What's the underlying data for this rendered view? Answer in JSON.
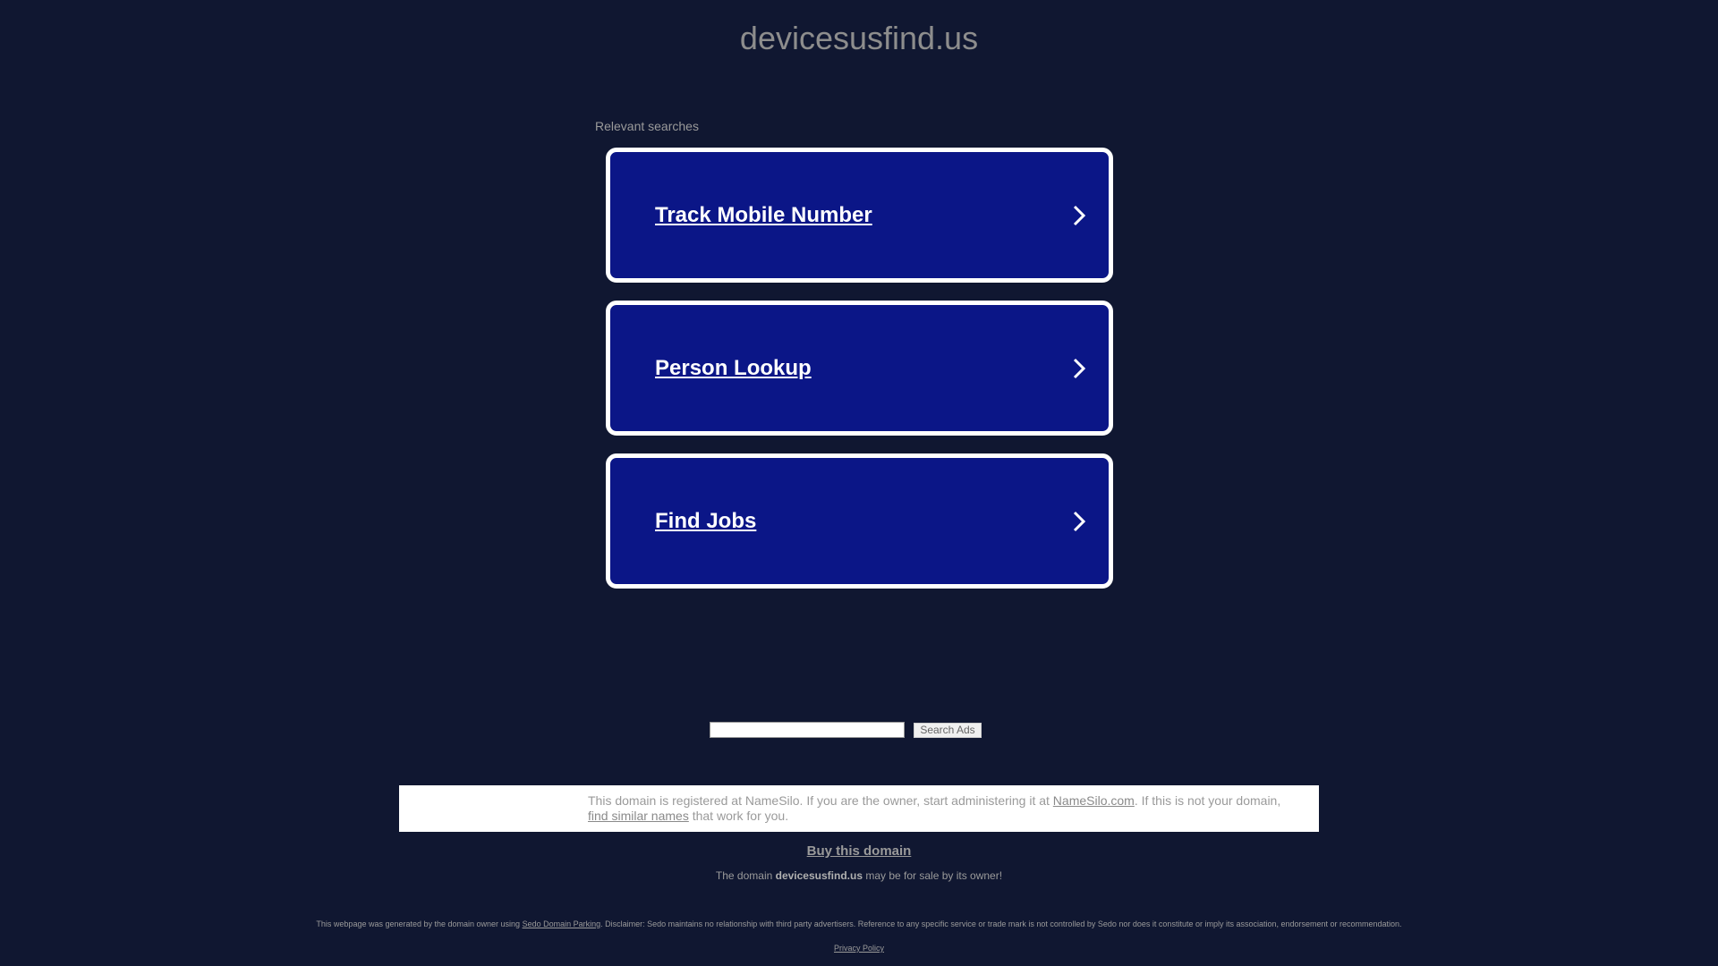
{
  "header": {
    "domain_title": "devicesusfind.us"
  },
  "searches": {
    "label": "Relevant searches",
    "items": [
      {
        "label": "Track Mobile Number"
      },
      {
        "label": "Person Lookup"
      },
      {
        "label": "Find Jobs"
      }
    ]
  },
  "search_box": {
    "input_value": "",
    "button_label": "Search Ads"
  },
  "notice": {
    "text_before": "This domain is registered at NameSilo. If you are the owner, start administering it at ",
    "link1": "NameSilo.com",
    "text_middle": ". If this is not your domain, ",
    "link2": "find similar names",
    "text_after": " that work for you."
  },
  "sale": {
    "buy_label": "Buy this domain",
    "prefix": "The domain ",
    "domain": "devicesusfind.us",
    "suffix": " may be for sale by its owner!"
  },
  "footer": {
    "disclaimer_before": "This webpage was generated by the domain owner using ",
    "disclaimer_link": "Sedo Domain Parking",
    "disclaimer_after": ". Disclaimer: Sedo maintains no relationship with third party advertisers. Reference to any specific service or trade mark is not controlled by Sedo nor does it constitute or imply its association, endorsement or recommendation.",
    "privacy_label": "Privacy Policy"
  },
  "colors": {
    "background": "#101731",
    "card_fill": "#0b1687",
    "card_border": "#ffffff"
  },
  "icons": {
    "card_arrow": "chevron-right-icon"
  }
}
